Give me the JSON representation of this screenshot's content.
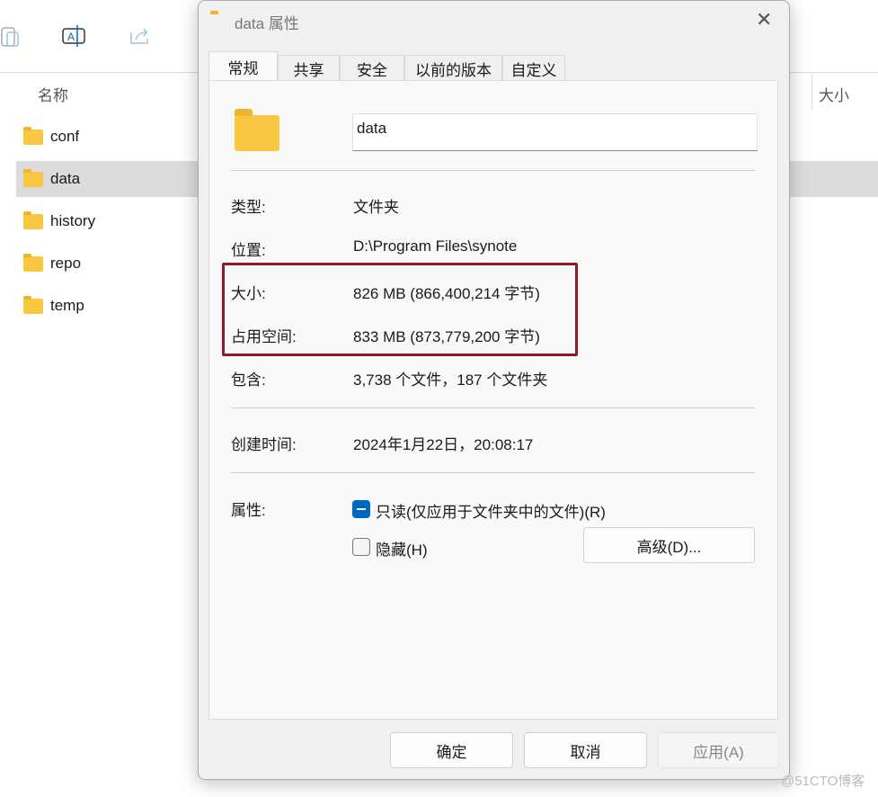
{
  "explorer": {
    "column_name": "名称",
    "column_size": "大小",
    "files": [
      "conf",
      "data",
      "history",
      "repo",
      "temp"
    ],
    "selected": "data"
  },
  "dialog": {
    "title": "data 属性",
    "tabs": [
      "常规",
      "共享",
      "安全",
      "以前的版本",
      "自定义"
    ],
    "name_value": "data",
    "fields": [
      {
        "label": "类型:",
        "value": "文件夹"
      },
      {
        "label": "位置:",
        "value": "D:\\Program Files\\synote"
      },
      {
        "label": "大小:",
        "value": "826 MB (866,400,214 字节)"
      },
      {
        "label": "占用空间:",
        "value": "833 MB (873,779,200 字节)"
      },
      {
        "label": "包含:",
        "value": "3,738 个文件，187 个文件夹"
      }
    ],
    "created_label": "创建时间:",
    "created_value": "2024年1月22日，20:08:17",
    "attributes_label": "属性:",
    "readonly_label": "只读(仅应用于文件夹中的文件)(R)",
    "readonly_state": "indeterminate",
    "hidden_label": "隐藏(H)",
    "hidden_checked": false,
    "advanced_button": "高级(D)...",
    "ok": "确定",
    "cancel": "取消",
    "apply": "应用(A)"
  },
  "highlight_color": "#8b1a2b",
  "accent": "#0067c0",
  "watermark": "@51CTO博客"
}
